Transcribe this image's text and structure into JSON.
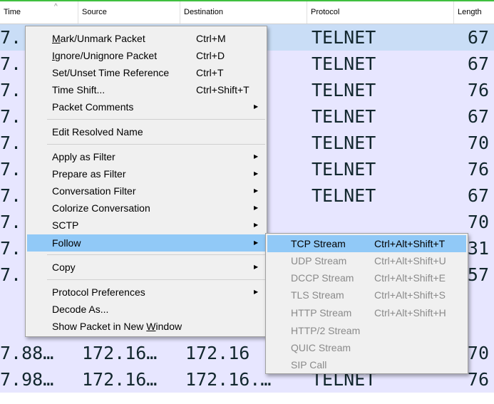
{
  "columns": [
    "Time",
    "Source",
    "Destination",
    "Protocol",
    "Length"
  ],
  "rows": [
    {
      "time": "7.",
      "src": "",
      "dst": ".…",
      "proto": "TELNET",
      "len": "67"
    },
    {
      "time": "7.",
      "src": "",
      "dst": ".…",
      "proto": "TELNET",
      "len": "67"
    },
    {
      "time": "7.",
      "src": "",
      "dst": ".…",
      "proto": "TELNET",
      "len": "76"
    },
    {
      "time": "7.",
      "src": "",
      "dst": ".…",
      "proto": "TELNET",
      "len": "67"
    },
    {
      "time": "7.",
      "src": "",
      "dst": ".…",
      "proto": "TELNET",
      "len": "70"
    },
    {
      "time": "7.",
      "src": "",
      "dst": ".…",
      "proto": "TELNET",
      "len": "76"
    },
    {
      "time": "7.",
      "src": "",
      "dst": ".…",
      "proto": "TELNET",
      "len": "67"
    },
    {
      "time": "7.",
      "src": "",
      "dst": "",
      "proto": "",
      "len": "70"
    },
    {
      "time": "7.",
      "src": "",
      "dst": "",
      "proto": "",
      "len": "31"
    },
    {
      "time": "7.",
      "src": "",
      "dst": "",
      "proto": "",
      "len": "57"
    },
    {
      "time": "7.88…",
      "src": "172.16…",
      "dst": "172.16",
      "proto": "",
      "len": "70"
    },
    {
      "time": "7.98…",
      "src": "172.16…",
      "dst": "172.16.…",
      "proto": "TELNET",
      "len": "76"
    }
  ],
  "context_menu": {
    "items": [
      {
        "pre": "",
        "ul": "M",
        "post": "ark/Unmark Packet",
        "shortcut": "Ctrl+M",
        "arrow": ""
      },
      {
        "pre": "",
        "ul": "I",
        "post": "gnore/Unignore Packet",
        "shortcut": "Ctrl+D",
        "arrow": ""
      },
      {
        "pre": "Set/Unset Time Reference",
        "ul": "",
        "post": "",
        "shortcut": "Ctrl+T",
        "arrow": ""
      },
      {
        "pre": "Time Shift...",
        "ul": "",
        "post": "",
        "shortcut": "Ctrl+Shift+T",
        "arrow": ""
      },
      {
        "pre": "Packet Comments",
        "ul": "",
        "post": "",
        "shortcut": "",
        "arrow": "▶"
      },
      {
        "pre": "Edit Resolved Name",
        "ul": "",
        "post": "",
        "shortcut": "",
        "arrow": ""
      },
      {
        "pre": "Apply as Filter",
        "ul": "",
        "post": "",
        "shortcut": "",
        "arrow": "▶"
      },
      {
        "pre": "Prepare as Filter",
        "ul": "",
        "post": "",
        "shortcut": "",
        "arrow": "▶"
      },
      {
        "pre": "Conversation Filter",
        "ul": "",
        "post": "",
        "shortcut": "",
        "arrow": "▶"
      },
      {
        "pre": "Colorize Conversation",
        "ul": "",
        "post": "",
        "shortcut": "",
        "arrow": "▶"
      },
      {
        "pre": "SCTP",
        "ul": "",
        "post": "",
        "shortcut": "",
        "arrow": "▶"
      },
      {
        "pre": "Follow",
        "ul": "",
        "post": "",
        "shortcut": "",
        "arrow": "▶"
      },
      {
        "pre": "Copy",
        "ul": "",
        "post": "",
        "shortcut": "",
        "arrow": "▶"
      },
      {
        "pre": "Protocol Preferences",
        "ul": "",
        "post": "",
        "shortcut": "",
        "arrow": "▶"
      },
      {
        "pre": "Decode As...",
        "ul": "",
        "post": "",
        "shortcut": "",
        "arrow": ""
      },
      {
        "pre": "Show Packet in New ",
        "ul": "W",
        "post": "indow",
        "shortcut": "",
        "arrow": ""
      }
    ]
  },
  "follow_submenu": {
    "items": [
      {
        "label": "TCP Stream",
        "shortcut": "Ctrl+Alt+Shift+T"
      },
      {
        "label": "UDP Stream",
        "shortcut": "Ctrl+Alt+Shift+U"
      },
      {
        "label": "DCCP Stream",
        "shortcut": "Ctrl+Alt+Shift+E"
      },
      {
        "label": "TLS Stream",
        "shortcut": "Ctrl+Alt+Shift+S"
      },
      {
        "label": "HTTP Stream",
        "shortcut": "Ctrl+Alt+Shift+H"
      },
      {
        "label": "HTTP/2 Stream",
        "shortcut": ""
      },
      {
        "label": "QUIC Stream",
        "shortcut": ""
      },
      {
        "label": "SIP Call",
        "shortcut": ""
      }
    ]
  },
  "colors": {
    "row_bg": "#e7e6ff",
    "selected_row_bg": "#c9ddf6",
    "menu_highlight": "#91c9f7",
    "disabled_text": "#8a8a8a"
  }
}
